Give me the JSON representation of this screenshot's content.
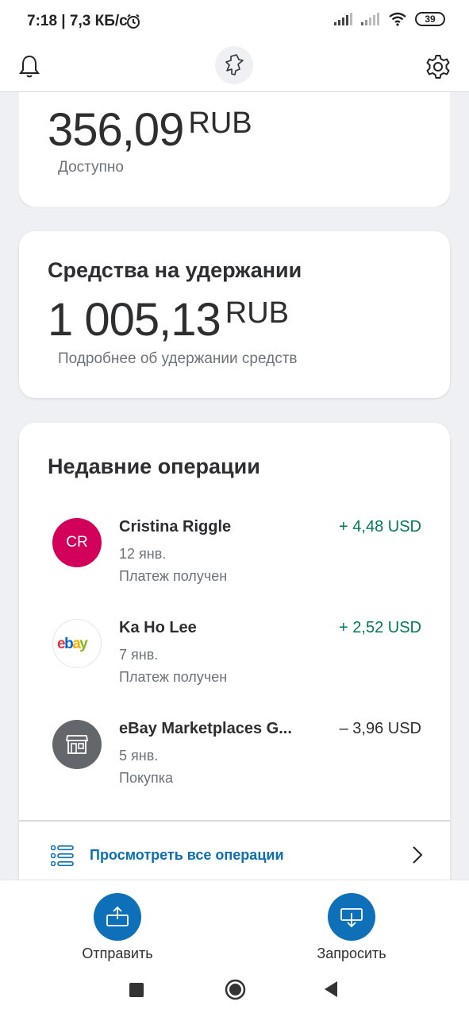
{
  "status_bar": {
    "time": "7:18 | 7,3 КБ/с",
    "battery": "39",
    "icons": [
      "alarm-icon",
      "signal-icon",
      "signal-icon",
      "wifi-icon",
      "battery-icon"
    ]
  },
  "app_bar": {
    "icons": [
      "bell-icon",
      "paypal-logo-icon",
      "gear-icon"
    ]
  },
  "balance": {
    "amount": "356,09",
    "currency": "RUB",
    "label": "Доступно"
  },
  "hold": {
    "title": "Средства на удержании",
    "amount": "1 005,13",
    "currency": "RUB",
    "link": "Подробнее об удержании средств"
  },
  "recent": {
    "title": "Недавние операции",
    "transactions": [
      {
        "avatar": "CR",
        "name": "Cristina Riggle",
        "date": "12 янв.",
        "status": "Платеж получен",
        "amount": "+ 4,48 USD",
        "direction": "in"
      },
      {
        "avatar": "ebay",
        "name": "Ka Ho Lee",
        "date": "7 янв.",
        "status": "Платеж получен",
        "amount": "+ 2,52 USD",
        "direction": "in"
      },
      {
        "avatar": "shop-icon",
        "name": "eBay Marketplaces G...",
        "date": "5 янв.",
        "status": "Покупка",
        "amount": "– 3,96 USD",
        "direction": "out"
      }
    ],
    "view_all": "Просмотреть все операции"
  },
  "actions": {
    "send": "Отправить",
    "request": "Запросить"
  },
  "colors": {
    "accent": "#0d70b8",
    "positive": "#017a5a",
    "avatar_cr": "#d3005b",
    "background": "#eef0f4"
  }
}
